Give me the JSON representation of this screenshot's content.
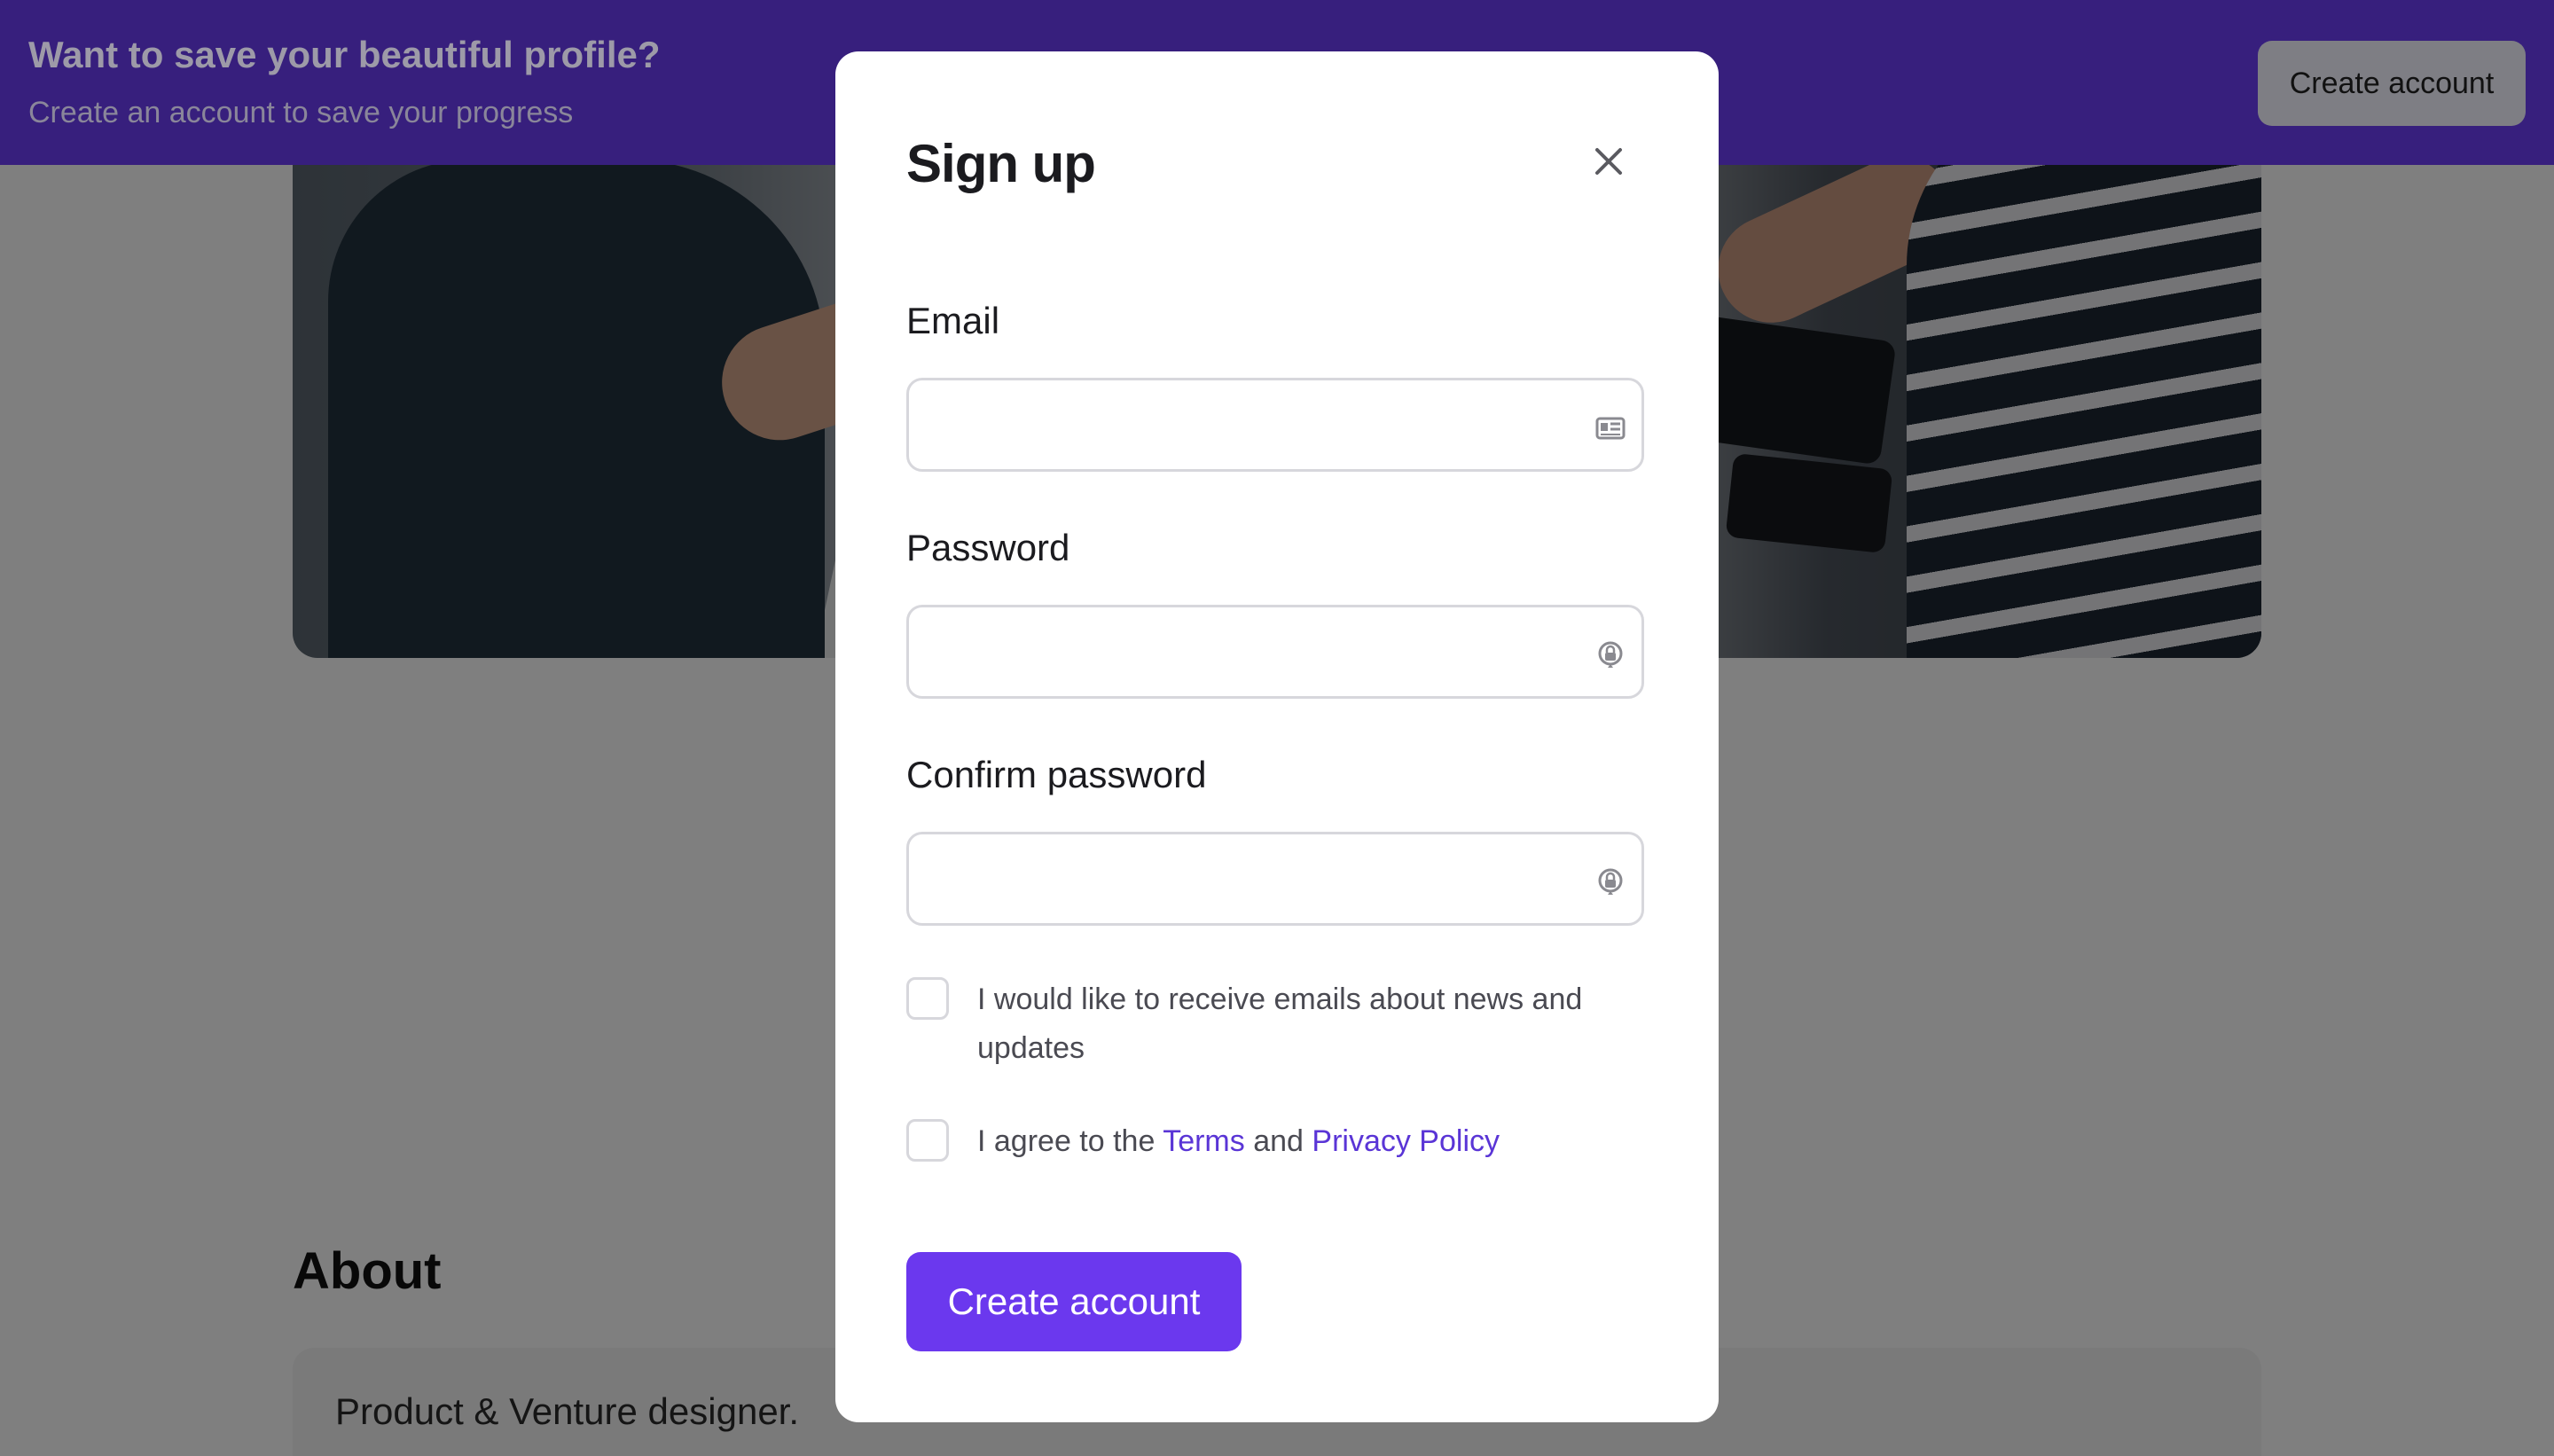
{
  "banner": {
    "title": "Want to save your beautiful profile?",
    "subtitle": "Create an account to save your progress",
    "button_label": "Create account"
  },
  "page": {
    "about_heading": "About",
    "about_text": "Product & Venture designer."
  },
  "modal": {
    "title": "Sign up",
    "close_icon": "close-icon",
    "email": {
      "label": "Email",
      "value": "",
      "icon": "contact-card-icon"
    },
    "password": {
      "label": "Password",
      "value": "",
      "icon": "password-manager-icon"
    },
    "confirm_password": {
      "label": "Confirm password",
      "value": "",
      "icon": "password-manager-icon"
    },
    "newsletter_checkbox": {
      "checked": false,
      "label": "I would like to receive emails about news and updates"
    },
    "terms_checkbox": {
      "checked": false,
      "prefix": "I agree to the ",
      "terms_link": "Terms",
      "conjunction": " and ",
      "privacy_link": "Privacy Policy"
    },
    "submit_label": "Create account"
  },
  "colors": {
    "banner_bg": "#371f7d",
    "accent": "#6b38ee",
    "link": "#5a35d6"
  }
}
